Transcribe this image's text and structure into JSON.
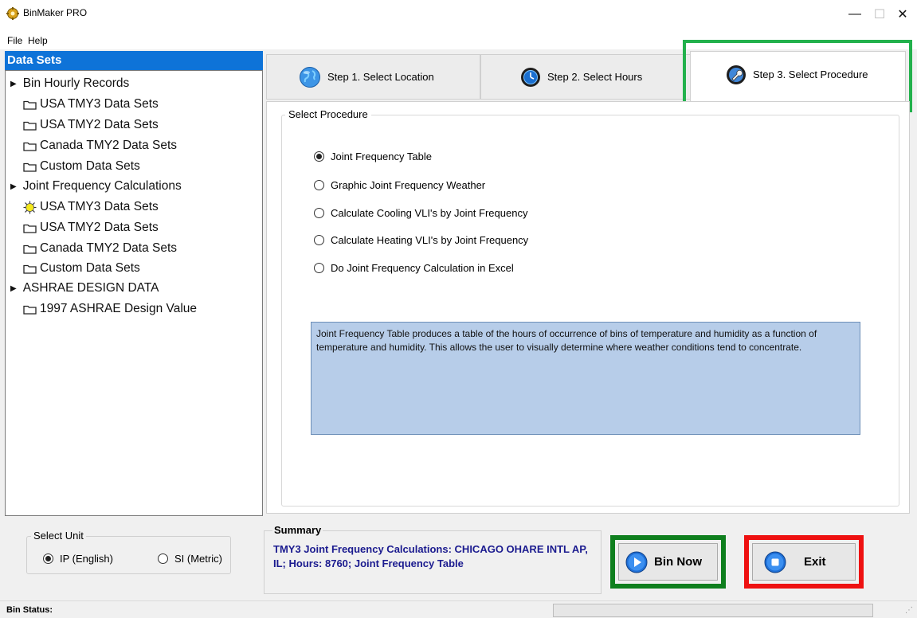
{
  "window": {
    "title": "BinMaker PRO",
    "minimize_glyph": "—",
    "maximize_glyph": "☐",
    "close_glyph": "✕"
  },
  "menu": [
    "File",
    "Help"
  ],
  "data_sets": {
    "header": "Data Sets",
    "items": [
      {
        "type": "group",
        "label": "Bin Hourly Records"
      },
      {
        "type": "folder",
        "label": "USA TMY3 Data Sets",
        "icon": "folder-icon"
      },
      {
        "type": "folder",
        "label": "USA TMY2 Data Sets",
        "icon": "folder-icon"
      },
      {
        "type": "folder",
        "label": "Canada TMY2 Data Sets",
        "icon": "folder-icon"
      },
      {
        "type": "folder",
        "label": "Custom Data Sets",
        "icon": "folder-icon"
      },
      {
        "type": "group",
        "label": "Joint Frequency Calculations"
      },
      {
        "type": "selected",
        "label": "USA TMY3 Data Sets",
        "icon": "sun-icon"
      },
      {
        "type": "folder",
        "label": "USA TMY2 Data Sets",
        "icon": "folder-icon"
      },
      {
        "type": "folder",
        "label": "Canada TMY2 Data Sets",
        "icon": "folder-icon"
      },
      {
        "type": "folder",
        "label": "Custom Data Sets",
        "icon": "folder-icon"
      },
      {
        "type": "group",
        "label": "ASHRAE DESIGN DATA"
      },
      {
        "type": "folder",
        "label": "1997 ASHRAE Design Value",
        "icon": "folder-icon"
      }
    ]
  },
  "tabs": [
    {
      "label": "Step 1.  Select Location",
      "icon": "globe-icon"
    },
    {
      "label": "Step 2.  Select Hours",
      "icon": "clock-icon"
    },
    {
      "label": "Step 3.  Select Procedure",
      "icon": "wrench-icon",
      "active": true
    }
  ],
  "procedure": {
    "group_title": "Select Procedure",
    "options": [
      {
        "label": "Joint Frequency Table",
        "checked": true
      },
      {
        "label": "Graphic Joint Frequency Weather",
        "checked": false
      },
      {
        "label": "Calculate Cooling VLI's by Joint Frequency",
        "checked": false
      },
      {
        "label": "Calculate Heating VLI's by Joint Frequency",
        "checked": false
      },
      {
        "label": "Do Joint Frequency Calculation in Excel",
        "checked": false
      }
    ],
    "description": "Joint Frequency Table produces a table of the hours of occurrence of bins of temperature and humidity as a function of temperature and humidity. This allows the user to visually determine where weather conditions tend to concentrate."
  },
  "unit": {
    "title": "Select Unit",
    "ip_label": "IP (English)",
    "si_label": "SI (Metric)",
    "selected": "ip"
  },
  "summary": {
    "title": "Summary",
    "text": "TMY3 Joint Frequency Calculations: CHICAGO OHARE INTL AP, IL; Hours:  8760; Joint Frequency Table"
  },
  "buttons": {
    "bin_now": "Bin Now",
    "exit": "Exit"
  },
  "status": {
    "label": "Bin Status:"
  },
  "colors": {
    "selection_blue": "#0e73d8",
    "description_bg": "#b7cde9",
    "summary_text": "#1b1b8f",
    "highlight_green_light": "#22b14c",
    "highlight_green_dark": "#0f7f1e",
    "highlight_red": "#ee1111"
  }
}
